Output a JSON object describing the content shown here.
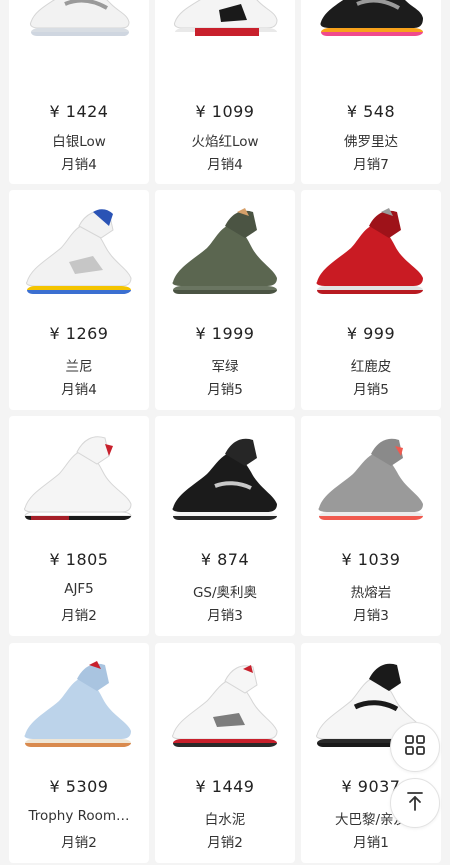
{
  "currency_symbol": "¥",
  "products": [
    {
      "price": "¥ 1424",
      "name": "白银Low",
      "sales": "月销4",
      "colors": {
        "upper": "#f2f2f2",
        "accent": "#9a9a9a",
        "sole": "#d8dde3",
        "outsole": "#cfd6e0"
      }
    },
    {
      "price": "¥ 1099",
      "name": "火焰红Low",
      "sales": "月销4",
      "colors": {
        "upper": "#f4f4f4",
        "accent": "#1a1a1a",
        "sole": "#c8202c",
        "outsole": "#e9e9e9"
      }
    },
    {
      "price": "¥ 548",
      "name": "佛罗里达",
      "sales": "月销7",
      "colors": {
        "upper": "#1c1c1c",
        "accent": "#f04a8c",
        "sole": "#f7a21b",
        "outsole": "#2a2a2a"
      }
    },
    {
      "price": "¥ 1269",
      "name": "兰尼",
      "sales": "月销4",
      "colors": {
        "upper": "#f2f2f2",
        "accent": "#2a53b5",
        "sole": "#f4c400",
        "outsole": "#3b6fd1"
      }
    },
    {
      "price": "¥ 1999",
      "name": "军绿",
      "sales": "月销5",
      "colors": {
        "upper": "#5b6650",
        "accent": "#3e4637",
        "sole": "#6a7561",
        "outsole": "#4b5443"
      }
    },
    {
      "price": "¥ 999",
      "name": "红鹿皮",
      "sales": "月销5",
      "colors": {
        "upper": "#c91b23",
        "accent": "#9e1219",
        "sole": "#e2e2e2",
        "outsole": "#b81a21"
      }
    },
    {
      "price": "¥ 1805",
      "name": "AJF5",
      "sales": "月销2",
      "colors": {
        "upper": "#f5f5f5",
        "accent": "#c8202c",
        "sole": "#ffffff",
        "outsole": "#1a1a1a"
      }
    },
    {
      "price": "¥ 874",
      "name": "GS/奥利奥",
      "sales": "月销3",
      "colors": {
        "upper": "#1b1b1b",
        "accent": "#c9c9c9",
        "sole": "#f4f4f4",
        "outsole": "#262626"
      }
    },
    {
      "price": "¥ 1039",
      "name": "热熔岩",
      "sales": "月销3",
      "colors": {
        "upper": "#9a9a9a",
        "accent": "#f05a4f",
        "sole": "#ececec",
        "outsole": "#f05a4f"
      }
    },
    {
      "price": "¥ 5309",
      "name": "Trophy Room…",
      "sales": "月销2",
      "colors": {
        "upper": "#bcd3ea",
        "accent": "#c8202c",
        "sole": "#efe6d6",
        "outsole": "#d98a4e"
      }
    },
    {
      "price": "¥ 1449",
      "name": "白水泥",
      "sales": "月销2",
      "colors": {
        "upper": "#f6f6f6",
        "accent": "#1a1a1a",
        "sole": "#c8202c",
        "outsole": "#2a2a2a"
      }
    },
    {
      "price": "¥ 9037",
      "name": "大巴黎/亲友",
      "sales": "月销1",
      "colors": {
        "upper": "#f6f6f6",
        "accent": "#1a1a1a",
        "sole": "#2a2a2a",
        "outsole": "#1a1a1a"
      }
    }
  ],
  "floating": {
    "grid_icon": "grid-icon",
    "top_icon": "arrow-up-icon"
  }
}
